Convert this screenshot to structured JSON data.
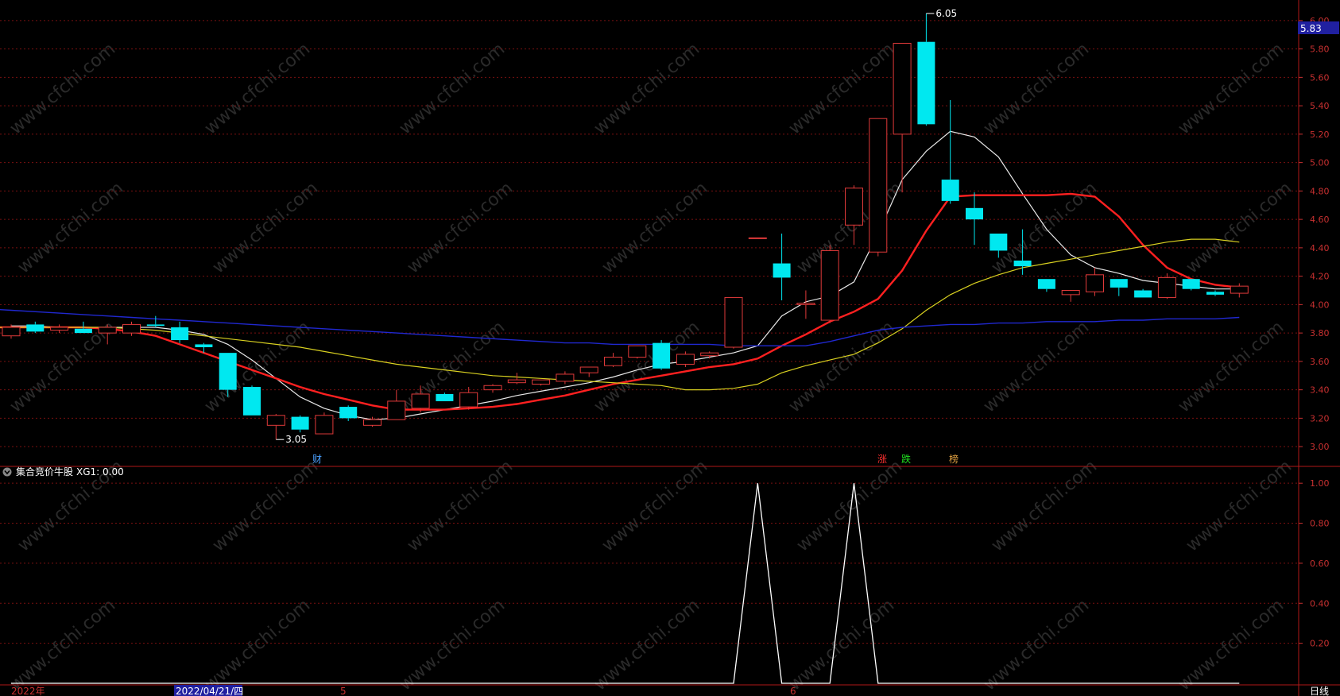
{
  "colors": {
    "background": "#000000",
    "frame": "#b01818",
    "grid": "#7a1010",
    "axis_text": "#c83030",
    "up": "#e03a3a",
    "down": "#00e8f0",
    "ma5": "#e8e8e8",
    "ma10": "#ff2020",
    "ma20": "#d8d020",
    "ma60": "#2028d0",
    "signal": "#ffffff",
    "price_tag_bg": "#2020a0"
  },
  "watermark": "www.cfchi.com",
  "price_axis": {
    "ticks": [
      "6.00",
      "5.80",
      "5.60",
      "5.40",
      "5.20",
      "5.00",
      "4.80",
      "4.60",
      "4.40",
      "4.20",
      "4.00",
      "3.80",
      "3.60",
      "3.40",
      "3.20",
      "3.00"
    ],
    "ylim": [
      2.9,
      6.1
    ],
    "current_price": "5.83"
  },
  "indicator_axis": {
    "ticks": [
      "1.00",
      "0.80",
      "0.60",
      "0.40",
      "0.20"
    ],
    "ylim": [
      0,
      1.1
    ]
  },
  "indicator_title": "集合竞价牛股",
  "indicator_value": "XG1: 0.00",
  "indicator_icon": "chevron-down-icon",
  "annotations": {
    "high": "6.05",
    "low": "3.05"
  },
  "markers": [
    {
      "label": "财",
      "color": "#4aa0ff"
    },
    {
      "label": "涨",
      "color": "#ff3030"
    },
    {
      "label": "跌",
      "color": "#20e020"
    },
    {
      "label": "榜",
      "color": "#e0a040"
    }
  ],
  "time_axis": {
    "labels": [
      "2022年",
      "2022/04/21/四",
      "5",
      "6"
    ]
  },
  "period_label": "日线",
  "chart_data": [
    {
      "type": "candlestick",
      "ylim": [
        2.9,
        6.1
      ],
      "candles": [
        [
          3.78,
          3.86,
          3.76,
          3.84
        ],
        [
          3.86,
          3.88,
          3.8,
          3.81
        ],
        [
          3.82,
          3.86,
          3.8,
          3.84
        ],
        [
          3.83,
          3.88,
          3.8,
          3.8
        ],
        [
          3.8,
          3.86,
          3.72,
          3.84
        ],
        [
          3.8,
          3.88,
          3.78,
          3.86
        ],
        [
          3.86,
          3.92,
          3.84,
          3.85
        ],
        [
          3.84,
          3.88,
          3.73,
          3.75
        ],
        [
          3.72,
          3.73,
          3.66,
          3.7
        ],
        [
          3.66,
          3.66,
          3.35,
          3.4
        ],
        [
          3.42,
          3.43,
          3.22,
          3.22
        ],
        [
          3.15,
          3.23,
          3.05,
          3.22
        ],
        [
          3.21,
          3.22,
          3.1,
          3.12
        ],
        [
          3.09,
          3.24,
          3.09,
          3.22
        ],
        [
          3.28,
          3.29,
          3.18,
          3.2
        ],
        [
          3.15,
          3.21,
          3.14,
          3.19
        ],
        [
          3.19,
          3.4,
          3.19,
          3.32
        ],
        [
          3.27,
          3.43,
          3.24,
          3.37
        ],
        [
          3.37,
          3.38,
          3.32,
          3.32
        ],
        [
          3.28,
          3.42,
          3.26,
          3.38
        ],
        [
          3.4,
          3.44,
          3.38,
          3.43
        ],
        [
          3.45,
          3.52,
          3.44,
          3.47
        ],
        [
          3.44,
          3.47,
          3.43,
          3.47
        ],
        [
          3.46,
          3.53,
          3.44,
          3.51
        ],
        [
          3.52,
          3.56,
          3.49,
          3.56
        ],
        [
          3.57,
          3.66,
          3.56,
          3.63
        ],
        [
          3.63,
          3.71,
          3.62,
          3.71
        ],
        [
          3.73,
          3.75,
          3.54,
          3.55
        ],
        [
          3.58,
          3.67,
          3.56,
          3.65
        ],
        [
          3.64,
          3.67,
          3.62,
          3.66
        ],
        [
          3.7,
          4.05,
          3.69,
          4.05
        ],
        [
          4.47,
          4.47,
          4.47,
          4.47
        ],
        [
          4.29,
          4.5,
          4.03,
          4.19
        ],
        [
          4.0,
          4.1,
          3.9,
          4.01
        ],
        [
          3.89,
          4.42,
          3.87,
          4.38
        ],
        [
          4.56,
          4.84,
          4.42,
          4.82
        ],
        [
          4.37,
          5.31,
          4.34,
          5.31
        ],
        [
          5.2,
          5.84,
          4.79,
          5.84
        ],
        [
          5.85,
          6.05,
          5.26,
          5.27
        ],
        [
          4.88,
          5.44,
          4.71,
          4.73
        ],
        [
          4.68,
          4.79,
          4.42,
          4.6
        ],
        [
          4.5,
          4.5,
          4.33,
          4.38
        ],
        [
          4.31,
          4.53,
          4.21,
          4.27
        ],
        [
          4.18,
          4.18,
          4.09,
          4.11
        ],
        [
          4.07,
          4.1,
          4.02,
          4.1
        ],
        [
          4.09,
          4.26,
          4.06,
          4.21
        ],
        [
          4.18,
          4.18,
          4.06,
          4.12
        ],
        [
          4.1,
          4.11,
          4.05,
          4.05
        ],
        [
          4.05,
          4.22,
          4.04,
          4.19
        ],
        [
          4.18,
          4.18,
          4.1,
          4.11
        ],
        [
          4.09,
          4.1,
          4.06,
          4.07
        ],
        [
          4.08,
          4.15,
          4.05,
          4.13
        ]
      ],
      "series": [
        {
          "name": "MA5",
          "values": [
            3.85,
            3.85,
            3.84,
            3.84,
            3.84,
            3.84,
            3.84,
            3.82,
            3.79,
            3.72,
            3.61,
            3.48,
            3.35,
            3.27,
            3.22,
            3.19,
            3.2,
            3.23,
            3.26,
            3.29,
            3.32,
            3.36,
            3.39,
            3.42,
            3.45,
            3.49,
            3.54,
            3.58,
            3.6,
            3.63,
            3.66,
            3.71,
            3.92,
            4.02,
            4.06,
            4.16,
            4.5,
            4.88,
            5.08,
            5.22,
            5.18,
            5.04,
            4.78,
            4.53,
            4.35,
            4.26,
            4.22,
            4.17,
            4.15,
            4.13,
            4.11,
            4.11
          ]
        },
        {
          "name": "MA10",
          "values": [
            3.84,
            3.84,
            3.84,
            3.84,
            3.84,
            3.84,
            3.84,
            3.83,
            3.81,
            3.78,
            3.72,
            3.66,
            3.6,
            3.54,
            3.48,
            3.42,
            3.37,
            3.33,
            3.29,
            3.26,
            3.26,
            3.26,
            3.27,
            3.28,
            3.3,
            3.33,
            3.36,
            3.4,
            3.44,
            3.47,
            3.5,
            3.53,
            3.56,
            3.58,
            3.62,
            3.71,
            3.79,
            3.88,
            3.95,
            4.04,
            4.24,
            4.52,
            4.76,
            4.77,
            4.77,
            4.77,
            4.77,
            4.78,
            4.76,
            4.62,
            4.42,
            4.26,
            4.18,
            4.14,
            4.12
          ]
        },
        {
          "name": "MA20",
          "values": [
            3.84,
            3.84,
            3.84,
            3.84,
            3.84,
            3.84,
            3.84,
            3.83,
            3.82,
            3.8,
            3.78,
            3.76,
            3.74,
            3.72,
            3.7,
            3.67,
            3.64,
            3.61,
            3.58,
            3.56,
            3.54,
            3.52,
            3.5,
            3.49,
            3.48,
            3.47,
            3.46,
            3.45,
            3.44,
            3.43,
            3.4,
            3.4,
            3.41,
            3.44,
            3.52,
            3.57,
            3.61,
            3.65,
            3.73,
            3.83,
            3.96,
            4.07,
            4.15,
            4.21,
            4.26,
            4.29,
            4.32,
            4.35,
            4.38,
            4.41,
            4.44,
            4.46,
            4.46,
            4.44
          ]
        },
        {
          "name": "MA60",
          "values": [
            3.98,
            3.97,
            3.96,
            3.95,
            3.94,
            3.93,
            3.92,
            3.91,
            3.9,
            3.89,
            3.88,
            3.87,
            3.86,
            3.85,
            3.84,
            3.83,
            3.82,
            3.81,
            3.8,
            3.79,
            3.78,
            3.77,
            3.76,
            3.75,
            3.74,
            3.73,
            3.73,
            3.72,
            3.72,
            3.72,
            3.72,
            3.72,
            3.71,
            3.71,
            3.71,
            3.71,
            3.74,
            3.78,
            3.82,
            3.84,
            3.85,
            3.86,
            3.86,
            3.87,
            3.87,
            3.88,
            3.88,
            3.88,
            3.89,
            3.89,
            3.9,
            3.9,
            3.9,
            3.91
          ]
        }
      ]
    },
    {
      "type": "line",
      "ylim": [
        0,
        1.1
      ],
      "series": [
        {
          "name": "XG1",
          "values": [
            0,
            0,
            0,
            0,
            0,
            0,
            0,
            0,
            0,
            0,
            0,
            0,
            0,
            0,
            0,
            0,
            0,
            0,
            0,
            0,
            0,
            0,
            0,
            0,
            0,
            0,
            0,
            0,
            0,
            0,
            0,
            1,
            0,
            0,
            0,
            1,
            0,
            0,
            0,
            0,
            0,
            0,
            0,
            0,
            0,
            0,
            0,
            0,
            0,
            0,
            0,
            0
          ]
        }
      ]
    }
  ]
}
